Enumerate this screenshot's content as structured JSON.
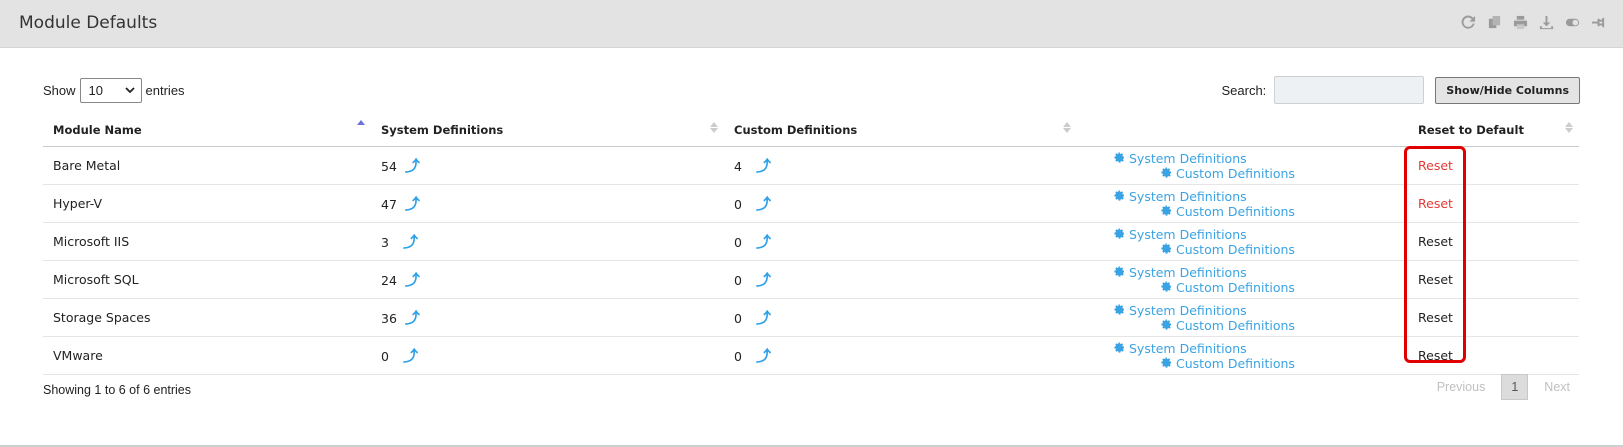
{
  "header": {
    "title": "Module Defaults",
    "icons": [
      "refresh-icon",
      "copy-icon",
      "print-icon",
      "download-icon",
      "toggle-icon",
      "pin-icon"
    ]
  },
  "controls": {
    "show_label": "Show",
    "entries_value": "10",
    "entries_label": "entries",
    "search_label": "Search:",
    "search_value": "",
    "columns_button": "Show/Hide Columns"
  },
  "table": {
    "columns": [
      "Module Name",
      "System Definitions",
      "Custom Definitions",
      "",
      "Reset to Default"
    ],
    "rows": [
      {
        "name": "Bare Metal",
        "system": "54",
        "custom": "4",
        "sys_link": "System Definitions",
        "cust_link": "Custom Definitions",
        "reset": "Reset"
      },
      {
        "name": "Hyper-V",
        "system": "47",
        "custom": "0",
        "sys_link": "System Definitions",
        "cust_link": "Custom Definitions",
        "reset": "Reset"
      },
      {
        "name": "Microsoft IIS",
        "system": "3",
        "custom": "0",
        "sys_link": "System Definitions",
        "cust_link": "Custom Definitions",
        "reset": "Reset"
      },
      {
        "name": "Microsoft SQL",
        "system": "24",
        "custom": "0",
        "sys_link": "System Definitions",
        "cust_link": "Custom Definitions",
        "reset": "Reset"
      },
      {
        "name": "Storage Spaces",
        "system": "36",
        "custom": "0",
        "sys_link": "System Definitions",
        "cust_link": "Custom Definitions",
        "reset": "Reset"
      },
      {
        "name": "VMware",
        "system": "0",
        "custom": "0",
        "sys_link": "System Definitions",
        "cust_link": "Custom Definitions",
        "reset": "Reset"
      }
    ]
  },
  "footer": {
    "info": "Showing 1 to 6 of 6 entries",
    "previous": "Previous",
    "page": "1",
    "next": "Next"
  },
  "colors": {
    "link": "#3aa3e3",
    "reset_highlight": "#e53935",
    "highlight_box": "#e10000"
  }
}
